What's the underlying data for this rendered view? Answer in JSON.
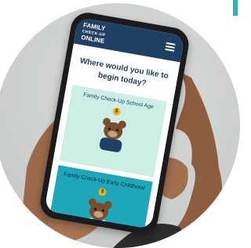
{
  "colors": {
    "accent": "#2bb3bf",
    "header_bg": "#1f3f63",
    "card_school": "#cdeee4",
    "card_early": "#1ea7b8",
    "coin": "#f0b21f",
    "bear": "#7a4e2d"
  },
  "app": {
    "logo_line1": "FAMILY",
    "logo_line2": "CHECK-UP",
    "logo_line3": "ONLINE",
    "menu_icon": "hamburger-menu-icon"
  },
  "main": {
    "heading": "Where would you like to begin today?",
    "cards": [
      {
        "title": "Family Check-Up School Age",
        "badge": "$",
        "illustration": "bear-icon"
      },
      {
        "title": "Family Check-Up Early Childhood",
        "badge": "$",
        "illustration": "bear-icon"
      }
    ]
  }
}
